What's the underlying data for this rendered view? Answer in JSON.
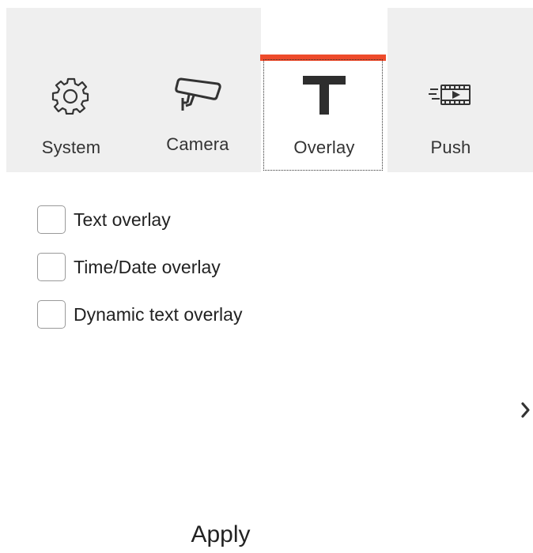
{
  "tabs": [
    {
      "id": "system",
      "label": "System",
      "icon": "gear-icon"
    },
    {
      "id": "camera",
      "label": "Camera",
      "icon": "camera-icon"
    },
    {
      "id": "overlay",
      "label": "Overlay",
      "icon": "text-t-icon",
      "active": true
    },
    {
      "id": "push",
      "label": "Push",
      "icon": "push-video-icon"
    }
  ],
  "colors": {
    "active_tab_accent": "#ee4b2b",
    "tabbar_background": "#efefef"
  },
  "overlay_options": [
    {
      "label": "Text overlay",
      "checked": false
    },
    {
      "label": "Time/Date overlay",
      "checked": false
    },
    {
      "label": "Dynamic text overlay",
      "checked": false
    }
  ],
  "apply_label": "Apply",
  "next_icon": "chevron-right-icon"
}
